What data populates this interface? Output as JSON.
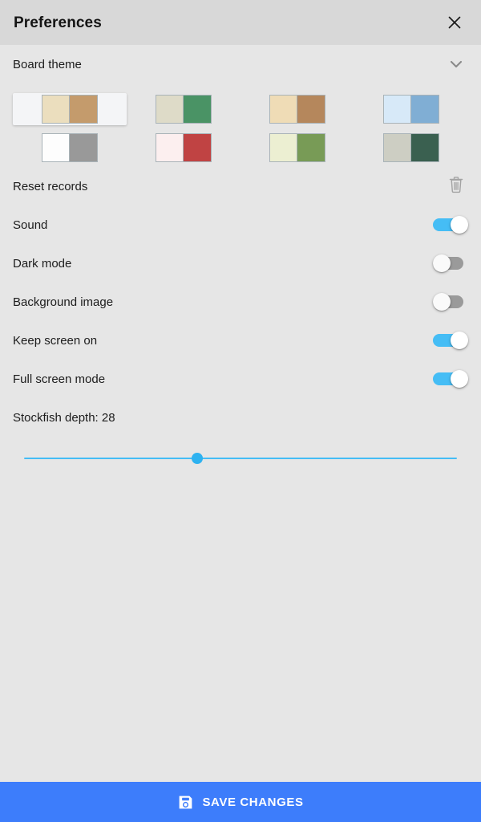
{
  "window": {
    "title": "Preferences",
    "close_icon": "close-icon"
  },
  "board_theme": {
    "label": "Board theme",
    "expand_icon": "chevron-down-icon",
    "selected_index": 0,
    "themes": [
      {
        "name": "brown",
        "light": "#EBDEBE",
        "dark": "#C49B6C",
        "selected": true
      },
      {
        "name": "green",
        "light": "#DEDBC8",
        "dark": "#4A9365",
        "selected": false
      },
      {
        "name": "tan",
        "light": "#EFDCB6",
        "dark": "#B5875C",
        "selected": false
      },
      {
        "name": "blue",
        "light": "#D7E9F8",
        "dark": "#80AED4",
        "selected": false
      },
      {
        "name": "grey",
        "light": "#FDFDFD",
        "dark": "#999999",
        "selected": false
      },
      {
        "name": "red",
        "light": "#FCEFEF",
        "dark": "#C04343",
        "selected": false
      },
      {
        "name": "olive",
        "light": "#ECEFD2",
        "dark": "#789B56",
        "selected": false
      },
      {
        "name": "dark-green",
        "light": "#CDCEC3",
        "dark": "#3A6050",
        "selected": false
      }
    ]
  },
  "settings": {
    "reset_records": {
      "label": "Reset records",
      "icon": "trash-icon"
    },
    "toggles": [
      {
        "key": "sound",
        "label": "Sound",
        "on": true
      },
      {
        "key": "dark_mode",
        "label": "Dark mode",
        "on": false
      },
      {
        "key": "background_image",
        "label": "Background image",
        "on": false
      },
      {
        "key": "keep_screen_on",
        "label": "Keep screen on",
        "on": true
      },
      {
        "key": "full_screen_mode",
        "label": "Full screen mode",
        "on": true
      }
    ],
    "stockfish_depth": {
      "label": "Stockfish depth: 28",
      "value": 28,
      "thumb_percent": 40
    }
  },
  "footer": {
    "save_label": "SAVE CHANGES",
    "save_icon": "save-floppy-icon",
    "accent_color": "#3d7dfb"
  },
  "colors": {
    "titlebar_bg": "#d8d8d8",
    "body_bg": "#e6e6e6",
    "toggle_on": "#45bdf5",
    "toggle_off": "#9a9a9a",
    "slider": "#2eb2f0"
  }
}
